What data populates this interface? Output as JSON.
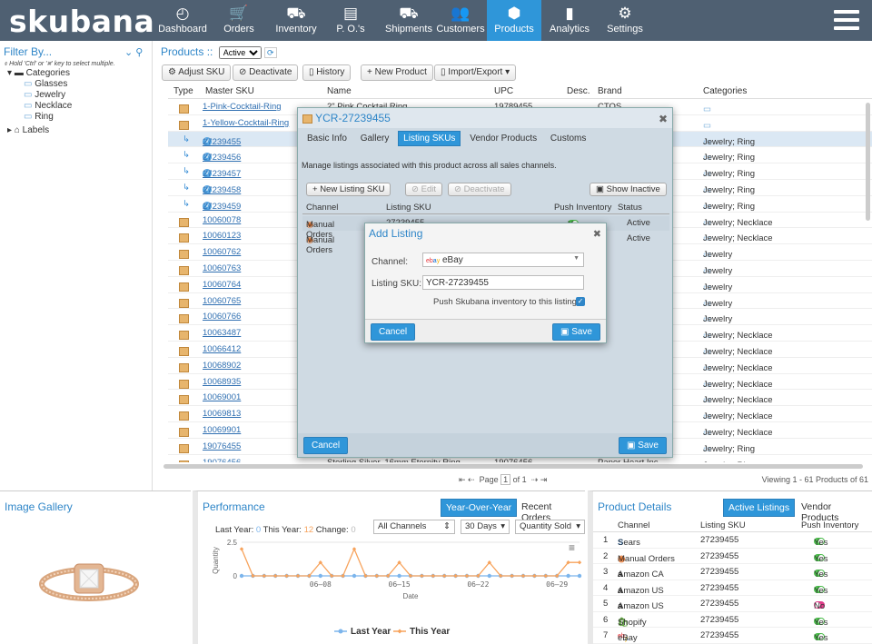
{
  "app": {
    "logo": "skubana"
  },
  "nav": [
    {
      "label": "Dashboard",
      "icon": "◴"
    },
    {
      "label": "Orders",
      "icon": "🛒"
    },
    {
      "label": "Inventory",
      "icon": "⛟"
    },
    {
      "label": "P. O.'s",
      "icon": "▤"
    },
    {
      "label": "Shipments",
      "icon": "⛟"
    },
    {
      "label": "Customers",
      "icon": "👥"
    },
    {
      "label": "Products",
      "icon": "⬢"
    },
    {
      "label": "Analytics",
      "icon": "▮"
    },
    {
      "label": "Settings",
      "icon": "⚙"
    }
  ],
  "filter": {
    "title": "Filter By...",
    "hint": "Hold 'Ctrl' or '⌘' key to select multiple.",
    "categories_label": "Categories",
    "categories": [
      "Glasses",
      "Jewelry",
      "Necklace",
      "Ring"
    ],
    "labels_label": "Labels"
  },
  "products": {
    "title": "Products ::",
    "status_filter": "Active",
    "toolbar": {
      "adjust_sku": "Adjust SKU",
      "deactivate": "Deactivate",
      "history": "History",
      "new_product": "New Product",
      "import_export": "Import/Export"
    },
    "columns": [
      "Type",
      "Master SKU",
      "Name",
      "UPC",
      "Desc.",
      "Brand",
      "Categories"
    ],
    "rows": [
      {
        "sku": "1-Pink-Cocktail-Ring",
        "name": "2\" Pink Cocktail Ring",
        "upc": "19789455",
        "brand": "CTOS",
        "cats": ""
      },
      {
        "sku": "1-Yellow-Cocktail-Ring",
        "name": "",
        "upc": "",
        "brand": "",
        "cats": ""
      },
      {
        "sku": "27239455",
        "name": "",
        "upc": "",
        "brand": "",
        "cats": "Jewelry; Ring"
      },
      {
        "sku": "27239456",
        "name": "",
        "upc": "",
        "brand": "",
        "cats": "Jewelry; Ring"
      },
      {
        "sku": "27239457",
        "name": "",
        "upc": "",
        "brand": "",
        "cats": "Jewelry; Ring"
      },
      {
        "sku": "27239458",
        "name": "",
        "upc": "",
        "brand": "",
        "cats": "Jewelry; Ring"
      },
      {
        "sku": "27239459",
        "name": "",
        "upc": "",
        "brand": "",
        "cats": "Jewelry; Ring"
      },
      {
        "sku": "10060078",
        "name": "",
        "upc": "",
        "brand": "",
        "cats": "Jewelry; Necklace"
      },
      {
        "sku": "10060123",
        "name": "",
        "upc": "",
        "brand": "",
        "cats": "Jewelry; Necklace"
      },
      {
        "sku": "10060762",
        "name": "",
        "upc": "",
        "brand": "",
        "cats": "Jewelry"
      },
      {
        "sku": "10060763",
        "name": "",
        "upc": "",
        "brand": "",
        "cats": "Jewelry"
      },
      {
        "sku": "10060764",
        "name": "",
        "upc": "",
        "brand": "",
        "cats": "Jewelry"
      },
      {
        "sku": "10060765",
        "name": "",
        "upc": "",
        "brand": "",
        "cats": "Jewelry"
      },
      {
        "sku": "10060766",
        "name": "",
        "upc": "",
        "brand": "",
        "cats": "Jewelry"
      },
      {
        "sku": "10063487",
        "name": "",
        "upc": "",
        "brand": "",
        "cats": "Jewelry; Necklace"
      },
      {
        "sku": "10066412",
        "name": "",
        "upc": "",
        "brand": "",
        "cats": "Jewelry; Necklace"
      },
      {
        "sku": "10068902",
        "name": "",
        "upc": "",
        "brand": "",
        "cats": "Jewelry; Necklace"
      },
      {
        "sku": "10068935",
        "name": "",
        "upc": "",
        "brand": "",
        "cats": "Jewelry; Necklace"
      },
      {
        "sku": "10069001",
        "name": "",
        "upc": "",
        "brand": "",
        "cats": "Jewelry; Necklace"
      },
      {
        "sku": "10069813",
        "name": "",
        "upc": "",
        "brand": "",
        "cats": "Jewelry; Necklace"
      },
      {
        "sku": "10069901",
        "name": "",
        "upc": "",
        "brand": "",
        "cats": "Jewelry; Necklace"
      },
      {
        "sku": "19076455",
        "name": "",
        "upc": "",
        "brand": "",
        "cats": "Jewelry; Ring"
      },
      {
        "sku": "19076456",
        "name": "Sterling Silver, 16mm Eternity Ring",
        "upc": "19076456",
        "brand": "Paper Heart Inc.",
        "cats": "Jewelry; Ring"
      }
    ],
    "page_label": "Page",
    "page_value": "1",
    "page_of": "of 1",
    "viewing": "Viewing 1 - 61 Products of 61"
  },
  "product_modal": {
    "title": "YCR-27239455",
    "tabs": [
      "Basic Info",
      "Gallery",
      "Listing SKUs",
      "Vendor Products",
      "Customs"
    ],
    "description": "Manage listings associated with this product across all sales channels.",
    "new_listing": "New Listing SKU",
    "edit": "Edit",
    "deactivate": "Deactivate",
    "show_inactive": "Show Inactive",
    "columns": [
      "Channel",
      "Listing SKU",
      "Push Inventory",
      "Status"
    ],
    "rows": [
      {
        "channel": "Manual Orders",
        "sku": "27239455",
        "push": "Yes",
        "status": "Active"
      },
      {
        "channel": "Manual Orders",
        "sku": "",
        "push": "",
        "status": "Active"
      }
    ],
    "cancel": "Cancel",
    "save": "Save"
  },
  "add_listing": {
    "title": "Add Listing",
    "channel_label": "Channel:",
    "channel_value": "eBay",
    "sku_label": "Listing SKU:",
    "sku_value": "YCR-27239455",
    "push_label": "Push Skubana inventory to this listing?",
    "cancel": "Cancel",
    "save": "Save"
  },
  "gallery": {
    "title": "Image Gallery"
  },
  "performance": {
    "title": "Performance",
    "tab_yoy": "Year-Over-Year",
    "tab_recent": "Recent Orders",
    "last_year_label": "Last Year:",
    "last_year_value": "0",
    "this_year_label": "This Year:",
    "this_year_value": "12",
    "change_label": "Change:",
    "change_value": "0",
    "channel_select": "All Channels",
    "range_select": "30 Days",
    "metric_select": "Quantity Sold"
  },
  "chart_data": {
    "type": "line",
    "xlabel": "Date",
    "ylabel": "Quantity",
    "ylim": [
      0,
      2.5
    ],
    "yticks": [
      "2.5",
      "0"
    ],
    "xticks": [
      "06–08",
      "06–15",
      "06–22",
      "06–29"
    ],
    "series": [
      {
        "name": "Last Year",
        "color": "#7cb5ec",
        "values": [
          0,
          0,
          0,
          0,
          0,
          0,
          0,
          0,
          0,
          0,
          0,
          0,
          0,
          0,
          0,
          0,
          0,
          0,
          0,
          0,
          0,
          0,
          0,
          0,
          0,
          0,
          0,
          0,
          0,
          0,
          0
        ]
      },
      {
        "name": "This Year",
        "color": "#f7a35c",
        "values": [
          2,
          0,
          0,
          0,
          0,
          0,
          0,
          1,
          0,
          0,
          2,
          0,
          0,
          0,
          1,
          0,
          0,
          0,
          0,
          0,
          0,
          0,
          1,
          0,
          0,
          0,
          0,
          0,
          0,
          1,
          1
        ]
      }
    ],
    "legend": "bottom"
  },
  "details": {
    "title": "Product Details",
    "tab_active": "Active Listings",
    "tab_vendor": "Vendor Products",
    "columns": [
      "Channel",
      "Listing SKU",
      "Push Inventory"
    ],
    "rows": [
      {
        "n": "1",
        "channel": "Sears",
        "icon": "S",
        "iconcolor": "#1d6fc4",
        "sku": "27239455",
        "push": "Yes",
        "on": true
      },
      {
        "n": "2",
        "channel": "Manual Orders",
        "icon": "◉",
        "iconcolor": "#e8742b",
        "sku": "27239455",
        "push": "Yes",
        "on": true
      },
      {
        "n": "3",
        "channel": "Amazon CA",
        "icon": "a",
        "iconcolor": "#222",
        "sku": "27239455",
        "push": "Yes",
        "on": true
      },
      {
        "n": "4",
        "channel": "Amazon US",
        "icon": "a",
        "iconcolor": "#222",
        "sku": "27239455",
        "push": "Yes",
        "on": true
      },
      {
        "n": "5",
        "channel": "Amazon US",
        "icon": "a",
        "iconcolor": "#222",
        "sku": "27239455",
        "push": "No",
        "on": false
      },
      {
        "n": "6",
        "channel": "Shopify",
        "icon": "🛍",
        "iconcolor": "#5a9e3a",
        "sku": "27239455",
        "push": "Yes",
        "on": true
      },
      {
        "n": "7",
        "channel": "eBay",
        "icon": "ebay",
        "iconcolor": "#e53238",
        "sku": "27239455",
        "push": "Yes",
        "on": true
      }
    ]
  }
}
